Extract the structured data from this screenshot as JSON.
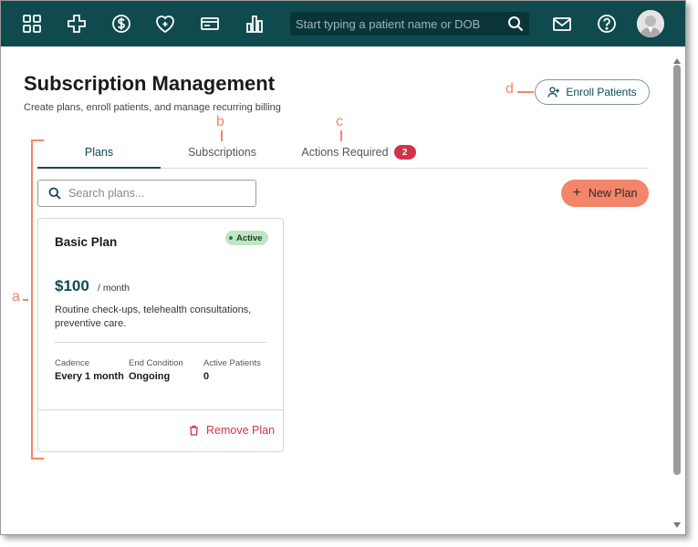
{
  "topbar": {
    "nav_icons": [
      "grid-icon",
      "plus-cross-icon",
      "dollar-icon",
      "heart-shield-icon",
      "card-icon",
      "bar-chart-icon"
    ],
    "search_placeholder": "Start typing a patient name or DOB",
    "right_icons": [
      "mail-icon",
      "help-icon"
    ],
    "bg_color": "#0f4a4f"
  },
  "page": {
    "title": "Subscription Management",
    "subtitle": "Create plans, enroll patients, and manage recurring billing",
    "enroll_label": "Enroll Patients"
  },
  "tabs": [
    {
      "label": "Plans",
      "active": true
    },
    {
      "label": "Subscriptions",
      "active": false
    },
    {
      "label": "Actions Required",
      "active": false,
      "badge": "2"
    }
  ],
  "plans": {
    "search_placeholder": "Search plans...",
    "new_label": "New Plan",
    "cards": [
      {
        "name": "Basic Plan",
        "status": "Active",
        "price": "$100",
        "period": "/ month",
        "description": "Routine check-ups, telehealth consultations, preventive care.",
        "meta": [
          {
            "label": "Cadence",
            "value": "Every 1 month"
          },
          {
            "label": "End Condition",
            "value": "Ongoing"
          },
          {
            "label": "Active Patients",
            "value": "0"
          }
        ],
        "remove_label": "Remove Plan"
      }
    ]
  },
  "annotations": {
    "a": "a",
    "b": "b",
    "c": "c",
    "d": "d",
    "color": "#f3866a"
  },
  "colors": {
    "accent": "#0f4a4f",
    "cta": "#f3866a",
    "danger": "#d0344a",
    "success_bg": "#bfe6c3"
  }
}
